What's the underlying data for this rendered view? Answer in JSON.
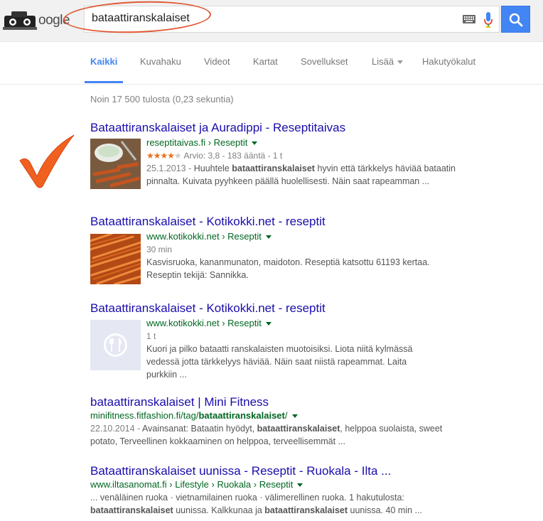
{
  "search": {
    "logo_text": "oogle",
    "query": "bataattiranskalaiset"
  },
  "tabs": [
    {
      "label": "Kaikki",
      "active": true
    },
    {
      "label": "Kuvahaku"
    },
    {
      "label": "Videot"
    },
    {
      "label": "Kartat"
    },
    {
      "label": "Sovellukset"
    },
    {
      "label": "Lisää"
    },
    {
      "label": "Hakutyökalut"
    }
  ],
  "stats": "Noin 17 500 tulosta (0,23 sekuntia)",
  "results": [
    {
      "title": "Bataattiranskalaiset ja Auradippi - Reseptitaivas",
      "url_host": "reseptitaivas.fi",
      "url_path": "› Reseptit",
      "rating_stars": 4,
      "rating_text": "Arvio: 3,8 - 183 ääntä - 1 t",
      "snippet_date": "25.1.2013 - ",
      "snippet_a": "Huuhtele ",
      "snippet_bold": "bataattiranskalaiset",
      "snippet_b": " hyvin että tärkkelys häviää bataatin pinnalta. Kuivata pyyhkeen päällä huolellisesti. Näin saat rapeamman ..."
    },
    {
      "title": "Bataattiranskalaiset - Kotikokki.net - reseptit",
      "url_host": "www.kotikokki.net",
      "url_path": "› Reseptit",
      "meta": "30 min",
      "snippet": "Kasvisruoka, kananmunaton, maidoton. Reseptiä katsottu 61193 kertaa. Reseptin tekijä: Sannikka."
    },
    {
      "title": "Bataattiranskalaiset - Kotikokki.net - reseptit",
      "url_host": "www.kotikokki.net",
      "url_path": "› Reseptit",
      "meta": "1 t",
      "snippet": "Kuori ja pilko bataatti ranskalaisten muotoisiksi. Liota niitä kylmässä vedessä jotta tärkkelyys häviää. Näin saat niistä rapeammat. Laita purkkiin ..."
    },
    {
      "title": "bataattiranskalaiset | Mini Fitness",
      "url_host": "minifitness.fitfashion.fi/tag/",
      "url_bold": "bataattiranskalaiset",
      "url_tail": "/",
      "snippet_date": "22.10.2014 - ",
      "snippet_a": "Avainsanat: Bataatin hyödyt, ",
      "snippet_bold": "bataattiranskalaiset",
      "snippet_b": ", helppoa suolaista, sweet potato, Terveellinen kokkaaminen on helppoa, terveellisemmät ..."
    },
    {
      "title": "Bataattiranskalaiset uunissa - Reseptit - Ruokala - Ilta ...",
      "url_host": "www.iltasanomat.fi",
      "url_path": "› Lifestyle › Ruokala › Reseptit",
      "snippet_a": "... venäläinen ruoka · vietnamilainen ruoka · välimerellinen ruoka. 1 hakutulosta: ",
      "snippet_bold": "bataattiranskalaiset",
      "snippet_b": " uunissa. Kalkkunaa ja ",
      "snippet_bold2": "bataattiranskalaiset",
      "snippet_c": " uunissa. 40 min ..."
    }
  ],
  "colors": {
    "accent": "#4285f4",
    "title": "#1a0dab",
    "url": "#006621",
    "check": "#f0601e"
  }
}
